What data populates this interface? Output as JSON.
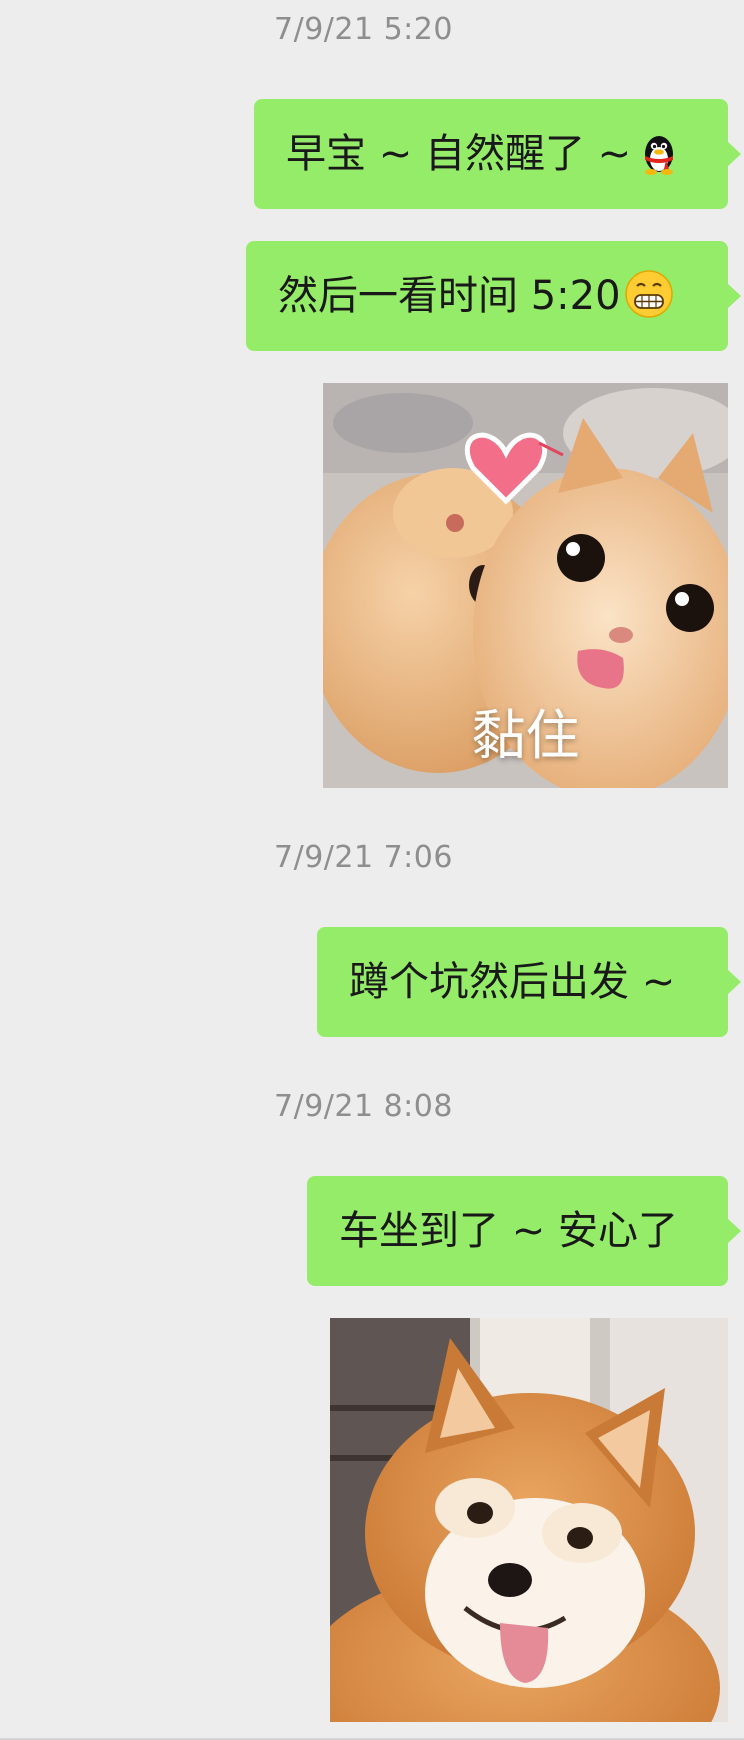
{
  "chat": {
    "timestamps": [
      "7/9/21 5:20",
      "7/9/21 7:06",
      "7/9/21 8:08"
    ],
    "messages": [
      {
        "text": "早宝 ~ 自然醒了 ~",
        "emoji": "qq-penguin-icon"
      },
      {
        "text": "然后一看时间 5:20",
        "emoji": "grinning-face-icon"
      },
      {
        "sticker": "two-orange-cats-cuddling",
        "caption": "黏住"
      },
      {
        "text": "蹲个坑然后出发 ~"
      },
      {
        "text": "车坐到了 ~ 安心了"
      },
      {
        "sticker": "smiling-shiba-inu-dog"
      }
    ]
  },
  "colors": {
    "background": "#ededed",
    "bubble": "#95ec69",
    "timestamp": "#8e8e8e"
  }
}
